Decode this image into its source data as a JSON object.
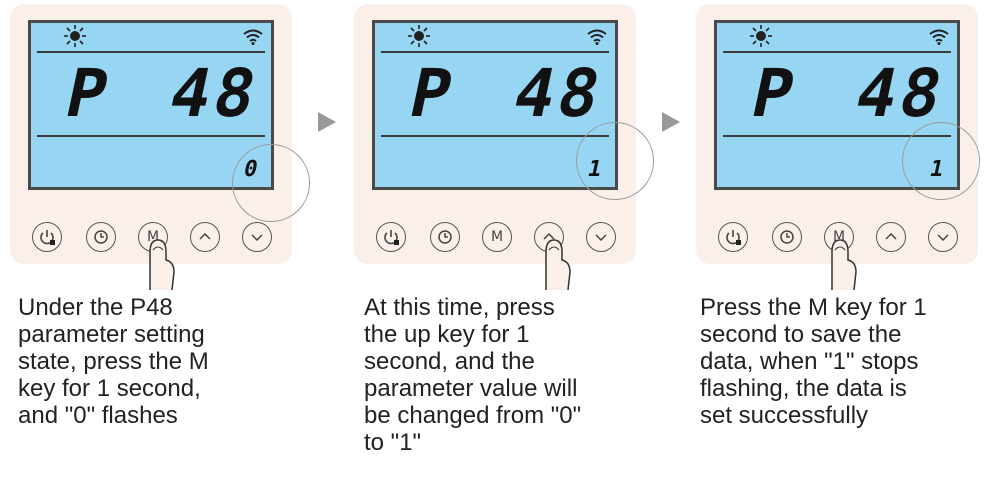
{
  "steps": [
    {
      "param_letter": "P",
      "param_number": "48",
      "value": "0",
      "pressed_key": "M",
      "caption": "Under the P48\nparameter setting\nstate, press the M\nkey for 1 second,\nand \"0\" flashes"
    },
    {
      "param_letter": "P",
      "param_number": "48",
      "value": "1",
      "pressed_key": "up",
      "caption": "At this time, press\nthe up key for 1\nsecond, and the\nparameter value will\nbe changed from \"0\"\nto \"1\""
    },
    {
      "param_letter": "P",
      "param_number": "48",
      "value": "1",
      "pressed_key": "M",
      "caption": "Press the M key for 1\nsecond to save the\ndata, when \"1\" stops\nflashing, the data is\nset successfully"
    }
  ],
  "buttons": {
    "mode_label": "M"
  },
  "icons": [
    "sun-icon",
    "wifi-icon",
    "power-lock-icon",
    "clock-icon",
    "up-chevron-icon",
    "down-chevron-icon",
    "finger-icon",
    "next-arrow-icon"
  ],
  "colors": {
    "panel_bg": "#fbefe9",
    "lcd_bg": "#96d6f3",
    "arrow": "#9a9a9a"
  }
}
